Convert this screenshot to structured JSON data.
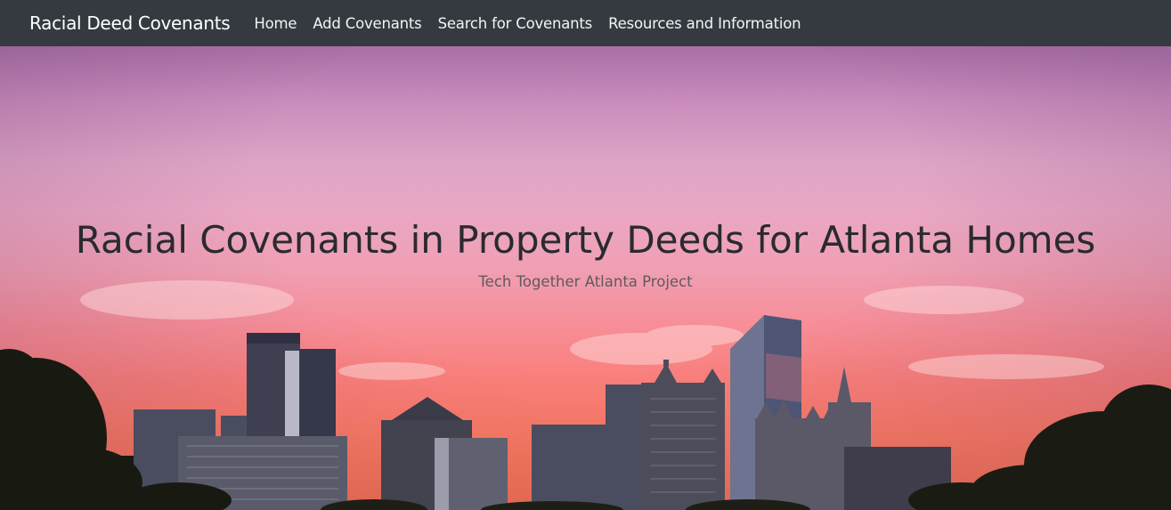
{
  "navbar": {
    "brand": "Racial Deed Covenants",
    "links": [
      {
        "label": "Home"
      },
      {
        "label": "Add Covenants"
      },
      {
        "label": "Search for Covenants"
      },
      {
        "label": "Resources and Information"
      }
    ],
    "background_color": "#343a40"
  },
  "hero": {
    "title": "Racial Covenants in Property Deeds for Atlanta Homes",
    "subtitle": "Tech Together Atlanta Project"
  }
}
